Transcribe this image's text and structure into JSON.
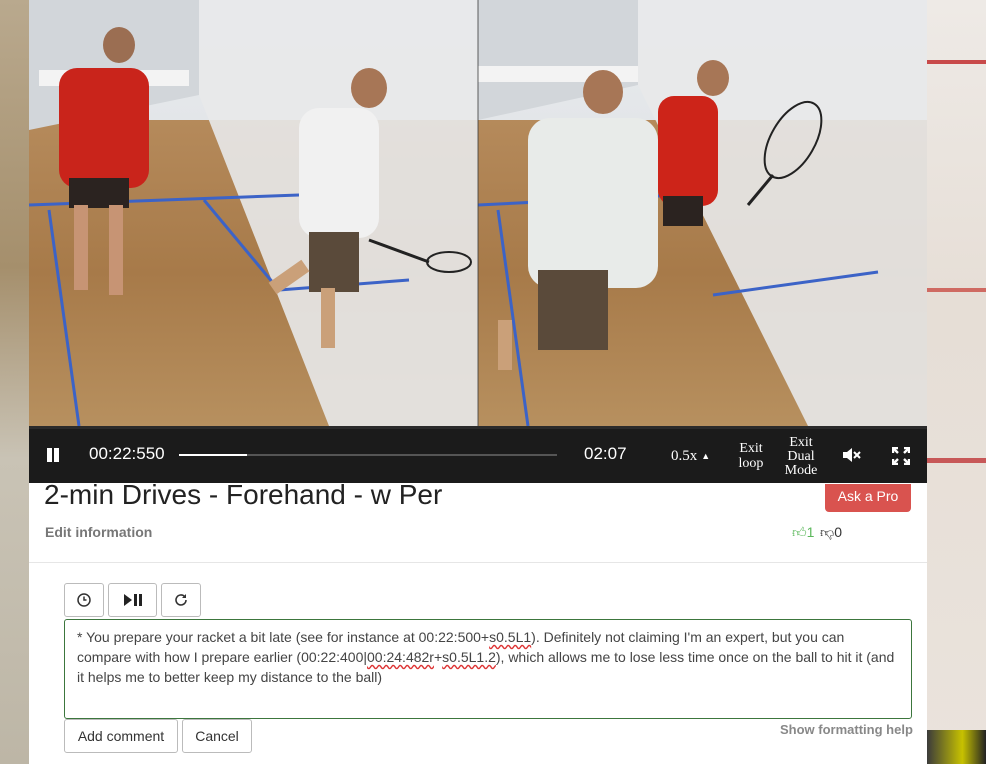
{
  "player": {
    "current_time": "00:22:550",
    "total_time": "02:07",
    "speed": "0.5x",
    "progress_fraction": 0.18,
    "exit_loop_line1": "Exit",
    "exit_loop_line2": "loop",
    "exit_dual_line1": "Exit",
    "exit_dual_line2": "Dual",
    "exit_dual_line3": "Mode"
  },
  "video": {
    "title": "2-min Drives - Forehand - w Per",
    "edit_label": "Edit information",
    "ask_pro_label": "Ask a Pro",
    "votes_up": "1",
    "votes_down": "0"
  },
  "comment": {
    "text_part1": "* You prepare your racket a bit late (see for instance at 00:22:500+",
    "text_sq1": "s0.5L1",
    "text_part2": "). Definitely not claiming I'm an expert, but you can compare with how I prepare earlier (00:22:400|",
    "text_sq2": "00:24:482r",
    "text_part3": "+",
    "text_sq3": "s0.5L1.2",
    "text_part4": "), which allows me to lose less time once on the ball to hit it (and it helps me to better keep my distance to the ball)",
    "add_label": "Add comment",
    "cancel_label": "Cancel",
    "help_label": "Show formatting help"
  },
  "icons": {
    "toolbar": [
      "clock-icon",
      "play-pause-icon",
      "refresh-icon"
    ],
    "thumbs_up": "thumbs-up-icon",
    "thumbs_down": "thumbs-down-icon"
  },
  "colors": {
    "ask_pro": "#d9534f",
    "vote_up": "#5cb85c",
    "comment_border": "#3c763d"
  }
}
